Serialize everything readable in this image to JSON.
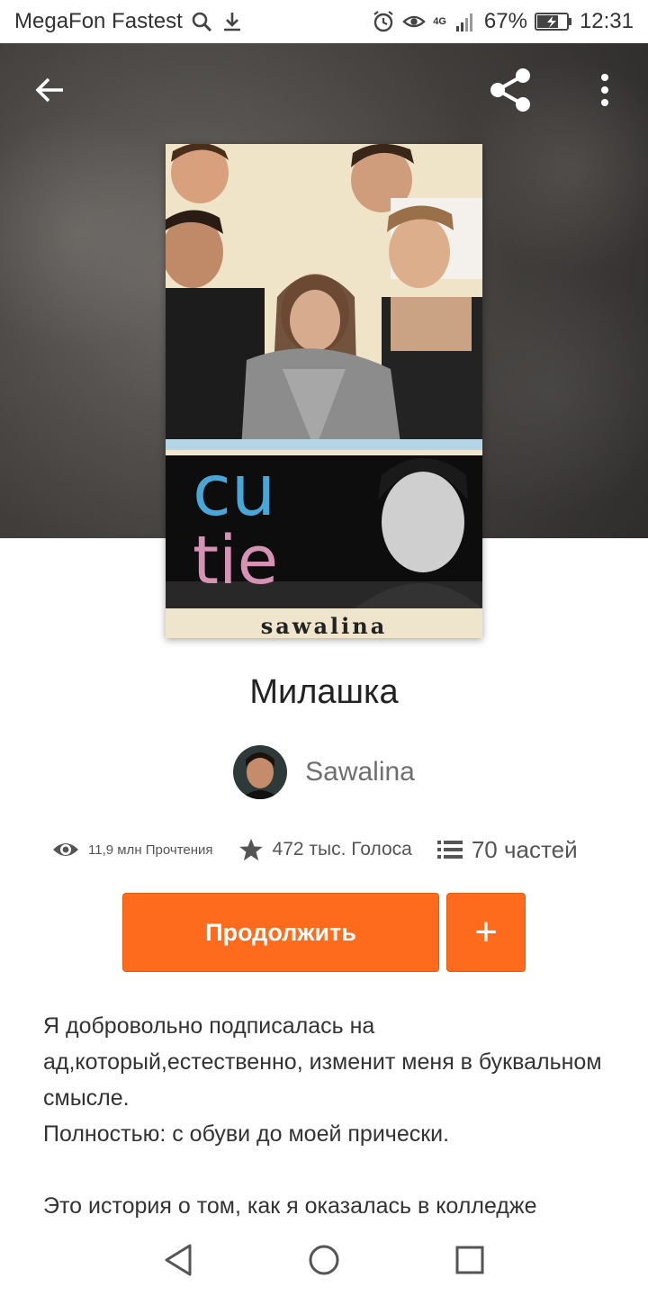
{
  "status_bar": {
    "carrier": "MegaFon Fastest",
    "network": "4G",
    "battery": "67%",
    "time": "12:31"
  },
  "cover": {
    "text_line1": "cu",
    "text_line2": "tie",
    "signature": "sawalina"
  },
  "story": {
    "title": "Милашка",
    "author": "Sawalina",
    "reads": "11,9 млн Прочтения",
    "votes": "472 тыс. Голоса",
    "parts": "70 частей"
  },
  "actions": {
    "continue_label": "Продолжить",
    "add_label": "+"
  },
  "description": {
    "paragraph1": "Я добровольно подписалась на ад,который,естественно, изменит меня  в буквальном смысле.",
    "paragraph1b": "Полностью: с обуви до моей прически.",
    "paragraph2": "Это история о том, как я оказалась в колледже"
  },
  "colors": {
    "accent": "#ff6b1c",
    "cover_text_blue": "#4aa6d6",
    "cover_text_pink": "#d592b5"
  },
  "icons": {
    "back": "arrow-left-icon",
    "share": "share-icon",
    "more": "more-vert-icon",
    "reads": "eye-icon",
    "votes": "star-icon",
    "parts": "list-icon",
    "nav_back": "triangle-back-icon",
    "nav_home": "circle-home-icon",
    "nav_recents": "square-recents-icon"
  }
}
